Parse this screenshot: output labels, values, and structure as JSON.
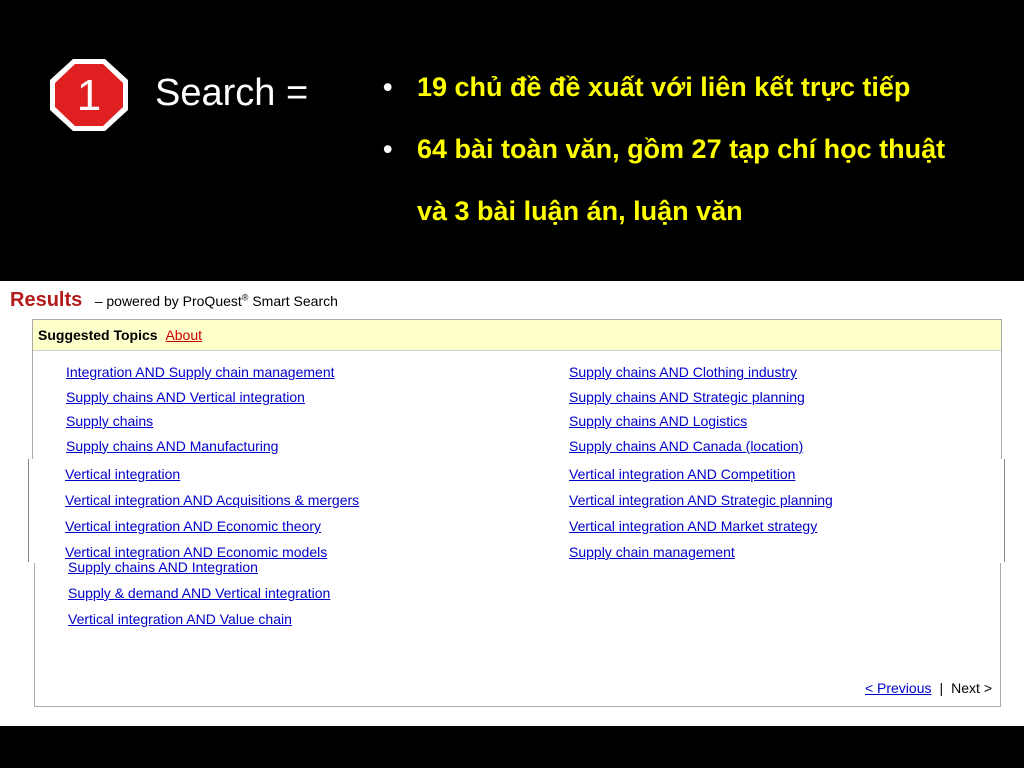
{
  "slide": {
    "step_number": "1",
    "search_label": "Search =",
    "bullets": [
      "19 chủ đề đề xuất với liên kết trực tiếp",
      "64 bài toàn văn, gồm 27 tạp chí học thuật",
      "và 3 bài luận án, luận văn"
    ],
    "colors": {
      "background": "#000000",
      "bullet_text": "#ffff00",
      "stop_sign": "#e02020"
    }
  },
  "results": {
    "title": "Results",
    "powered_by": "– powered by ProQuest",
    "registered_mark": "®",
    "smart_search": "Smart Search",
    "suggested_topics_label": "Suggested Topics",
    "about_link": "About",
    "top_left": [
      "Integration AND Supply chain management",
      "Supply chains AND Vertical integration",
      "Supply chains",
      "Supply chains AND Manufacturing"
    ],
    "top_right": [
      "Supply chains AND Clothing industry",
      "Supply chains AND Strategic planning",
      "Supply chains AND Logistics",
      "Supply chains AND Canada (location)"
    ],
    "mid_left": [
      "Vertical integration",
      "Vertical integration AND Acquisitions & mergers",
      "Vertical integration AND Economic theory",
      "Vertical integration AND Economic models"
    ],
    "mid_right": [
      "Vertical integration AND Competition",
      "Vertical integration AND Strategic planning",
      "Vertical integration AND Market strategy",
      "Supply chain management"
    ],
    "bottom_left": [
      "Supply chains AND Integration",
      "Supply & demand AND Vertical integration",
      "Vertical integration AND Value chain"
    ],
    "pager": {
      "previous": "< Previous",
      "separator": "|",
      "next": "Next >"
    }
  }
}
